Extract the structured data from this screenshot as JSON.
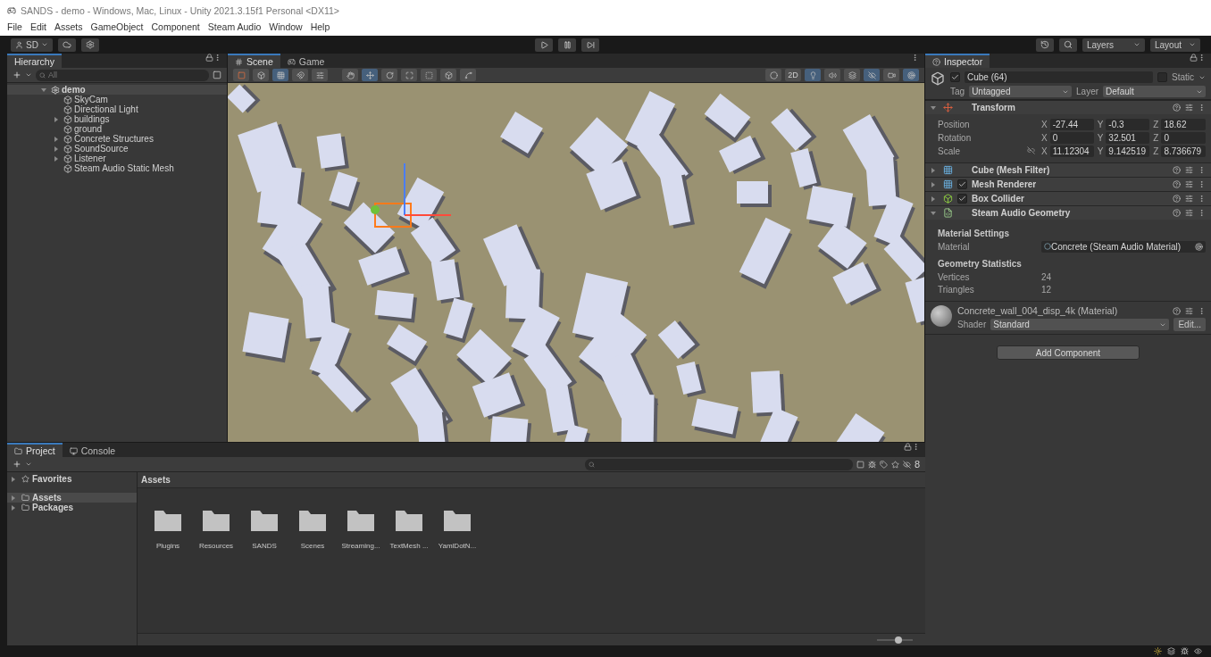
{
  "window": {
    "title": "SANDS - demo - Windows, Mac, Linux - Unity 2021.3.15f1 Personal <DX11>"
  },
  "menu": [
    "File",
    "Edit",
    "Assets",
    "GameObject",
    "Component",
    "Steam Audio",
    "Window",
    "Help"
  ],
  "toolbar": {
    "account": "SD",
    "layers": "Layers",
    "layout": "Layout"
  },
  "hierarchy": {
    "tab": "Hierarchy",
    "search_placeholder": "All",
    "tree": [
      {
        "label": "demo",
        "expanded": true,
        "children": [
          {
            "label": "SkyCam"
          },
          {
            "label": "Directional Light"
          },
          {
            "label": "buildings",
            "expanded": false
          },
          {
            "label": "ground"
          },
          {
            "label": "Concrete Structures",
            "expanded": false
          },
          {
            "label": "SoundSource",
            "expanded": false
          },
          {
            "label": "Listener",
            "expanded": false
          },
          {
            "label": "Steam Audio Static Mesh"
          }
        ]
      }
    ]
  },
  "scene": {
    "tabs": [
      {
        "label": "Scene",
        "selected": true
      },
      {
        "label": "Game",
        "selected": false
      }
    ],
    "toggle_2d": "2D",
    "tools": [
      {
        "kind": "hand",
        "selected": false
      },
      {
        "kind": "move",
        "selected": true
      },
      {
        "kind": "rotate",
        "selected": false
      },
      {
        "kind": "scale",
        "selected": false
      },
      {
        "kind": "rect",
        "selected": false
      },
      {
        "kind": "transform",
        "selected": false
      },
      {
        "kind": "custom",
        "selected": false
      }
    ]
  },
  "inspector": {
    "tab": "Inspector",
    "object": {
      "name": "Cube (64)",
      "active": true,
      "static": false,
      "static_label": "Static",
      "tag_label": "Tag",
      "tag": "Untagged",
      "layer_label": "Layer",
      "layer": "Default"
    },
    "components": [
      {
        "kind": "transform",
        "name": "Transform",
        "expanded": true,
        "rows": [
          {
            "label": "Position",
            "fields": [
              {
                "axis": "X",
                "value": "-27.44"
              },
              {
                "axis": "Y",
                "value": "-0.3"
              },
              {
                "axis": "Z",
                "value": "18.62"
              }
            ]
          },
          {
            "label": "Rotation",
            "fields": [
              {
                "axis": "X",
                "value": "0"
              },
              {
                "axis": "Y",
                "value": "32.501"
              },
              {
                "axis": "Z",
                "value": "0"
              }
            ]
          },
          {
            "label": "Scale",
            "linked": false,
            "fields": [
              {
                "axis": "X",
                "value": "11.12304"
              },
              {
                "axis": "Y",
                "value": "9.142519"
              },
              {
                "axis": "Z",
                "value": "8.736679"
              }
            ]
          }
        ]
      },
      {
        "kind": "mesh_filter",
        "name": "Cube (Mesh Filter)",
        "expanded": false
      },
      {
        "kind": "renderer",
        "name": "Mesh Renderer",
        "expanded": false,
        "enabled": true
      },
      {
        "kind": "collider",
        "name": "Box Collider",
        "expanded": false,
        "enabled": true
      },
      {
        "kind": "script",
        "name": "Steam Audio Geometry",
        "expanded": true,
        "sections": [
          {
            "heading": "Material Settings",
            "rows": [
              {
                "label": "Material",
                "value": "Concrete (Steam Audio Material)",
                "kind": "object"
              }
            ]
          },
          {
            "heading": "Geometry Statistics",
            "rows": [
              {
                "label": "Vertices",
                "value": "24",
                "kind": "text"
              },
              {
                "label": "Triangles",
                "value": "12",
                "kind": "text"
              }
            ]
          }
        ]
      }
    ],
    "material": {
      "name": "Concrete_wall_004_disp_4k (Material)",
      "shader_label": "Shader",
      "shader": "Standard",
      "edit": "Edit..."
    },
    "add_component": "Add Component"
  },
  "project": {
    "tabs": [
      {
        "label": "Project",
        "selected": true
      },
      {
        "label": "Console",
        "selected": false
      }
    ],
    "hidden_count": "8",
    "favorites": "Favorites",
    "roots": [
      {
        "label": "Assets",
        "selected": true
      },
      {
        "label": "Packages",
        "selected": false
      }
    ],
    "breadcrumb": "Assets",
    "folders": [
      "Plugins",
      "Resources",
      "SANDS",
      "Scenes",
      "Streaming...",
      "TextMesh ...",
      "YamlDotN..."
    ],
    "zoom": {
      "level": 0.6
    }
  }
}
